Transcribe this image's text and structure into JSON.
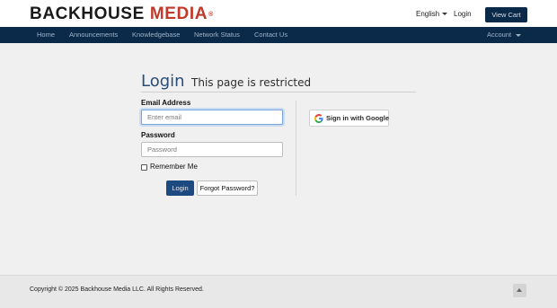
{
  "header": {
    "logo_word1": "BACKHOUSE",
    "logo_word2": "MEDIA",
    "logo_registered": "®",
    "language": "English",
    "login": "Login",
    "view_cart": "View Cart"
  },
  "nav": {
    "items": [
      "Home",
      "Announcements",
      "Knowledgebase",
      "Network Status",
      "Contact Us"
    ],
    "account": "Account"
  },
  "login_form": {
    "title": "Login",
    "subtitle": "This page is restricted",
    "email_label": "Email Address",
    "email_placeholder": "Enter email",
    "email_value": "",
    "password_label": "Password",
    "password_placeholder": "Password",
    "password_value": "",
    "remember_me": "Remember Me",
    "remember_checked": false,
    "login_button": "Login",
    "forgot_button": "Forgot Password?",
    "google_button": "Sign in with Google"
  },
  "footer": {
    "copyright": "Copyright © 2025 Backhouse Media LLC. All Rights Reserved."
  },
  "colors": {
    "nav_bg": "#0b2a4a",
    "brand_red": "#c0392b",
    "heading_blue": "#2a4d78",
    "login_button": "#1e4a82"
  },
  "icons": [
    "caret-down-icon",
    "google-icon",
    "arrow-up-icon"
  ]
}
